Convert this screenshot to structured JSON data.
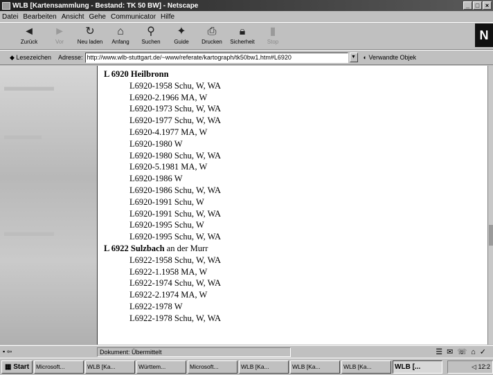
{
  "window": {
    "title": "WLB [Kartensammlung - Bestand: TK 50 BW] - Netscape"
  },
  "menu": [
    "Datei",
    "Bearbeiten",
    "Ansicht",
    "Gehe",
    "Communicator",
    "Hilfe"
  ],
  "toolbar": {
    "buttons": [
      {
        "label": "Zurück",
        "icon": "back-arrow-icon"
      },
      {
        "label": "Vor",
        "icon": "forward-arrow-icon"
      },
      {
        "label": "Neu laden",
        "icon": "reload-icon"
      },
      {
        "label": "Anfang",
        "icon": "home-icon"
      },
      {
        "label": "Suchen",
        "icon": "search-icon"
      },
      {
        "label": "Guide",
        "icon": "guide-icon"
      },
      {
        "label": "Drucken",
        "icon": "print-icon"
      },
      {
        "label": "Sicherheit",
        "icon": "security-icon"
      },
      {
        "label": "Stop",
        "icon": "stop-icon"
      }
    ],
    "logo": "N"
  },
  "location": {
    "bookmarks": "Lesezeichen",
    "address_label": "Adresse:",
    "url": "http://www.wlb-stuttgart.de/~www/referate/kartograph/tk50bw1.htm#L6920",
    "related": "Verwandte Objek"
  },
  "content": {
    "sections": [
      {
        "head_bold": "L 6920 Heilbronn",
        "head_rest": "",
        "entries": [
          "L6920-1958 Schu, W, WA",
          "L6920-2.1966 MA, W",
          "L6920-1973 Schu, W, WA",
          "L6920-1977 Schu, W, WA",
          "L6920-4.1977 MA, W",
          "L6920-1980 W",
          "L6920-1980 Schu, W, WA",
          "L6920-5.1981 MA, W",
          "L6920-1986 W",
          "L6920-1986 Schu, W, WA",
          "L6920-1991 Schu, W",
          "L6920-1991 Schu, W, WA",
          "L6920-1995 Schu, W",
          "L6920-1995 Schu, W, WA"
        ]
      },
      {
        "head_bold": "L 6922 Sulzbach",
        "head_rest": " an der Murr",
        "entries": [
          "L6922-1958 Schu, W, WA",
          "L6922-1.1958 MA, W",
          "L6922-1974 Schu, W, WA",
          "L6922-2.1974 MA, W",
          "L6922-1978 W",
          "L6922-1978 Schu, W, WA"
        ]
      }
    ]
  },
  "status": {
    "text": "Dokument: Übermittelt"
  },
  "taskbar": {
    "start": "Start",
    "tasks": [
      "Microsoft...",
      "WLB [Ka...",
      "Württem...",
      "Microsoft...",
      "WLB [Ka...",
      "WLB [Ka...",
      "WLB [Ka...",
      "WLB [..."
    ],
    "clock": "12:2"
  }
}
